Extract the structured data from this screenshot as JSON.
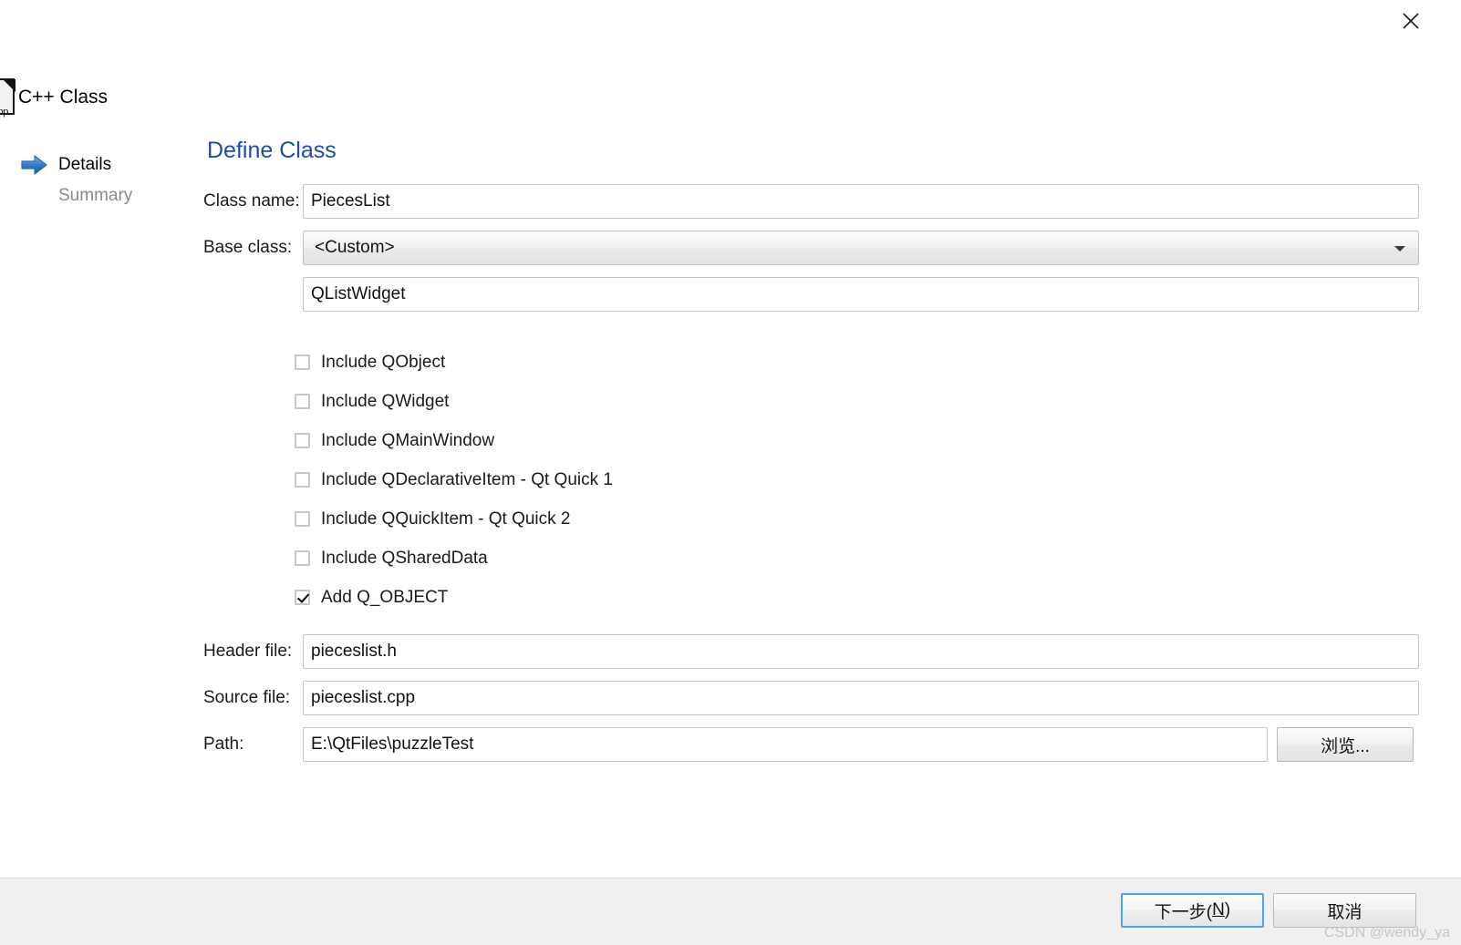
{
  "window": {
    "close_label": "×",
    "close_icon": "close-icon"
  },
  "wizard": {
    "title": "C++ Class",
    "file_icon_ext": "h/cpp",
    "nav": [
      {
        "label": "Details",
        "state": "active",
        "icon": "blue-arrow-icon"
      },
      {
        "label": "Summary",
        "state": "inactive",
        "icon": "none"
      }
    ]
  },
  "main": {
    "section_title": "Define Class",
    "fields": {
      "class_name": {
        "label": "Class name:",
        "value": "PiecesList"
      },
      "base_class": {
        "label": "Base class:",
        "value": "<Custom>",
        "options": [
          "<Custom>"
        ]
      },
      "custom_base": {
        "label": "",
        "value": "QListWidget"
      },
      "header_file": {
        "label": "Header file:",
        "value": "pieceslist.h"
      },
      "source_file": {
        "label": "Source file:",
        "value": "pieceslist.cpp"
      },
      "path": {
        "label": "Path:",
        "value": "E:\\QtFiles\\puzzleTest"
      }
    },
    "browse_button": "浏览...",
    "checkboxes": [
      {
        "label": "Include QObject",
        "checked": false
      },
      {
        "label": "Include QWidget",
        "checked": false
      },
      {
        "label": "Include QMainWindow",
        "checked": false
      },
      {
        "label": "Include QDeclarativeItem - Qt Quick 1",
        "checked": false
      },
      {
        "label": "Include QQuickItem - Qt Quick 2",
        "checked": false
      },
      {
        "label": "Include QSharedData",
        "checked": false
      },
      {
        "label": "Add Q_OBJECT",
        "checked": true
      }
    ]
  },
  "footer": {
    "next_button_prefix": "下一步(",
    "next_button_mnemonic": "N",
    "next_button_suffix": ")",
    "cancel_button": "取消",
    "watermark": "CSDN @wendy_ya"
  },
  "colors": {
    "accent_blue": "#1b4ea8",
    "focus_border": "#4da3e8",
    "footer_bg": "#f0f0f0",
    "inactive_text": "#8a8a8a"
  }
}
